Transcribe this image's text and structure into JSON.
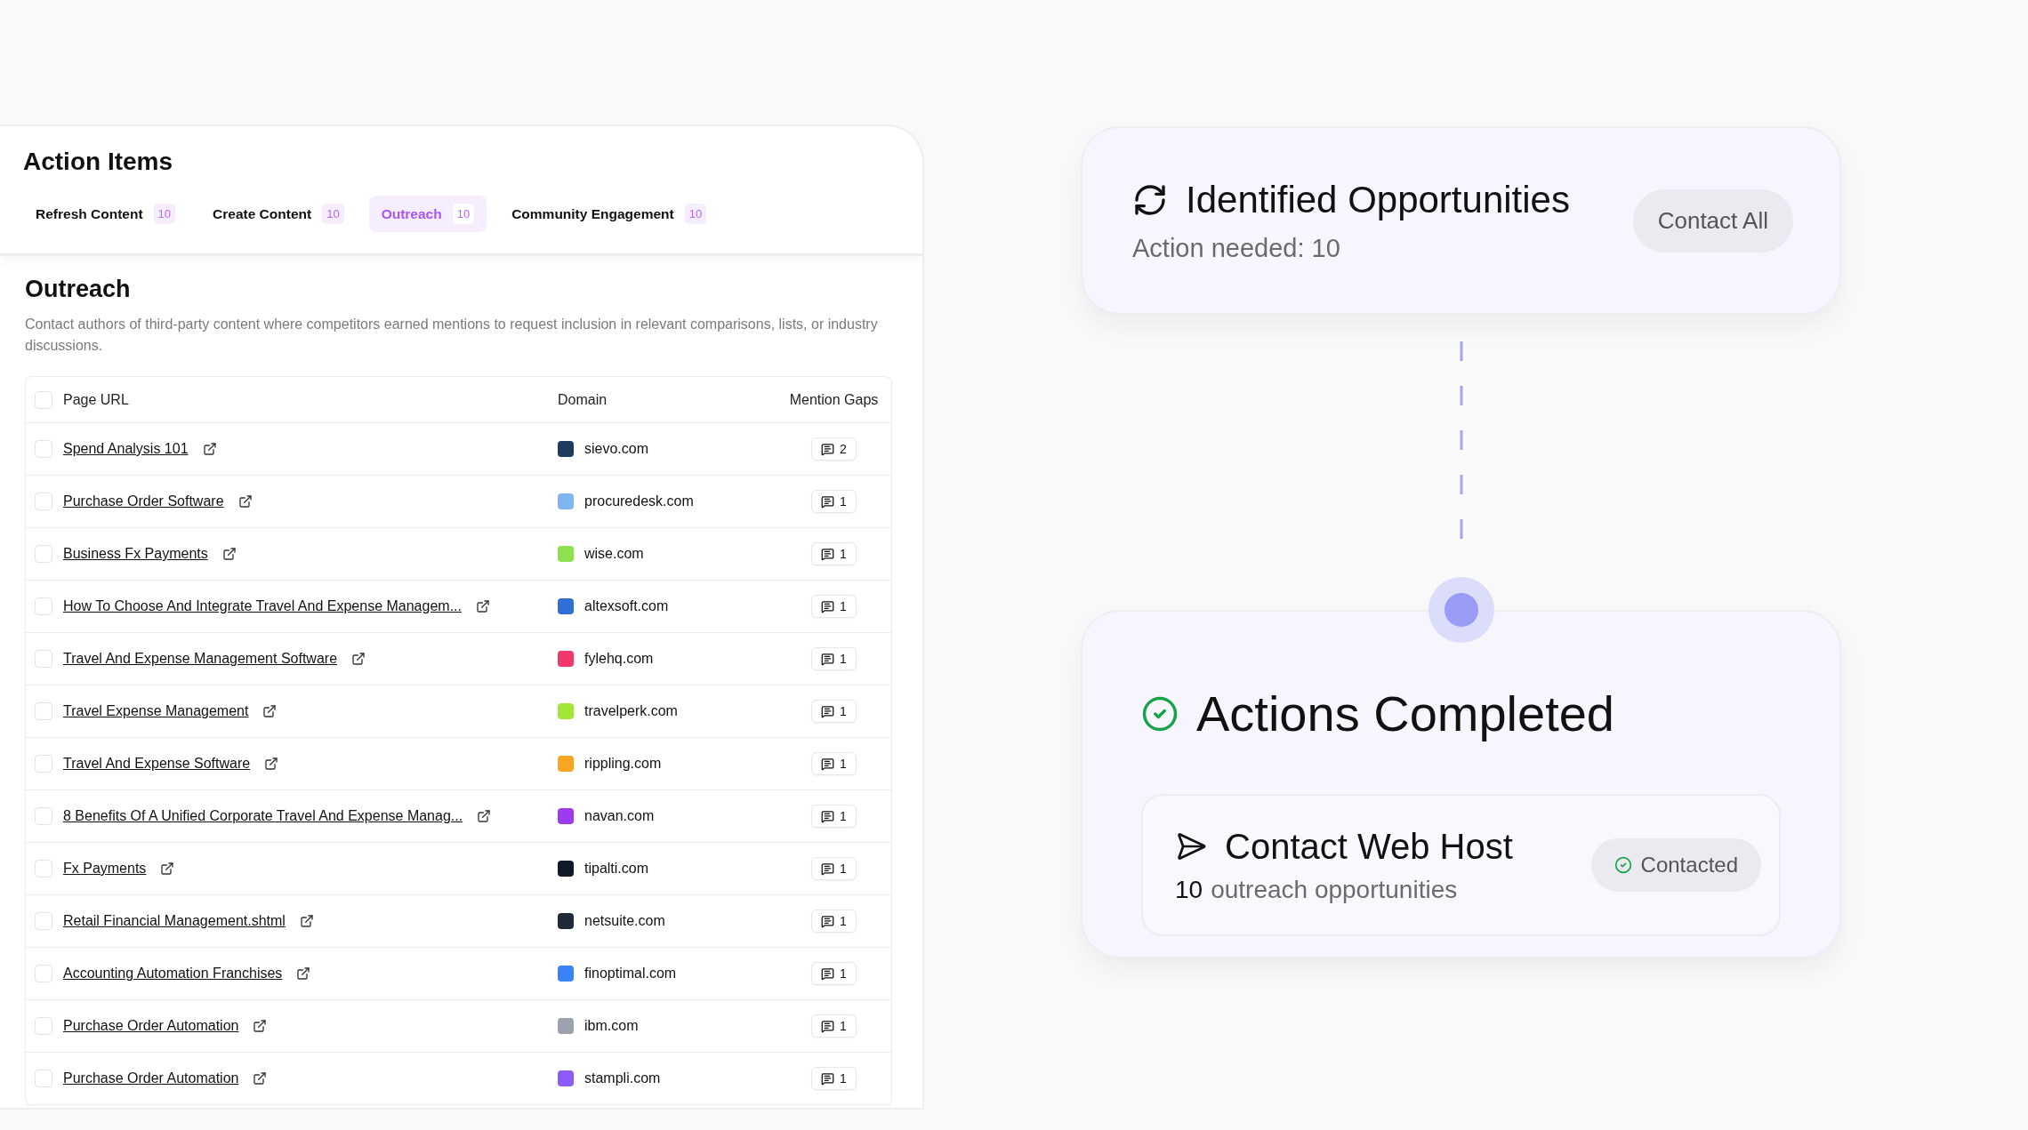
{
  "panel": {
    "title": "Action Items",
    "tabs": [
      {
        "label": "Refresh Content",
        "count": "10",
        "selected": false
      },
      {
        "label": "Create Content",
        "count": "10",
        "selected": false
      },
      {
        "label": "Outreach",
        "count": "10",
        "selected": true
      },
      {
        "label": "Community Engagement",
        "count": "10",
        "selected": false
      }
    ],
    "section": {
      "title": "Outreach",
      "description": "Contact authors of third-party content where competitors earned mentions to request inclusion in relevant comparisons, lists, or industry discussions."
    },
    "table": {
      "select_all_checked": false,
      "columns": [
        "Page URL",
        "Domain",
        "Mention Gaps"
      ],
      "rows": [
        {
          "checked": false,
          "page_url": "Spend Analysis 101",
          "domain": "sievo.com",
          "color": "#1e3a5f",
          "mention_gaps": "2"
        },
        {
          "checked": false,
          "page_url": "Purchase Order Software",
          "domain": "procuredesk.com",
          "color": "#7fb6f0",
          "mention_gaps": "1"
        },
        {
          "checked": false,
          "page_url": "Business Fx Payments",
          "domain": "wise.com",
          "color": "#8ee04f",
          "mention_gaps": "1"
        },
        {
          "checked": false,
          "page_url": "How To Choose And Integrate Travel And Expense Managem...",
          "domain": "altexsoft.com",
          "color": "#2f6fd6",
          "mention_gaps": "1"
        },
        {
          "checked": false,
          "page_url": "Travel And Expense Management Software",
          "domain": "fylehq.com",
          "color": "#f0386b",
          "mention_gaps": "1"
        },
        {
          "checked": false,
          "page_url": "Travel Expense Management",
          "domain": "travelperk.com",
          "color": "#a3e635",
          "mention_gaps": "1"
        },
        {
          "checked": false,
          "page_url": "Travel And Expense Software",
          "domain": "rippling.com",
          "color": "#f5a623",
          "mention_gaps": "1"
        },
        {
          "checked": false,
          "page_url": "8 Benefits Of A Unified Corporate Travel And Expense Manag...",
          "domain": "navan.com",
          "color": "#9b3cf0",
          "mention_gaps": "1"
        },
        {
          "checked": false,
          "page_url": "Fx Payments",
          "domain": "tipalti.com",
          "color": "#111827",
          "mention_gaps": "1"
        },
        {
          "checked": false,
          "page_url": "Retail Financial Management.shtml",
          "domain": "netsuite.com",
          "color": "#1f2937",
          "mention_gaps": "1"
        },
        {
          "checked": false,
          "page_url": "Accounting Automation Franchises",
          "domain": "finoptimal.com",
          "color": "#3b82f6",
          "mention_gaps": "1"
        },
        {
          "checked": false,
          "page_url": "Purchase Order Automation",
          "domain": "ibm.com",
          "color": "#9ca3af",
          "mention_gaps": "1"
        },
        {
          "checked": false,
          "page_url": "Purchase Order Automation",
          "domain": "stampli.com",
          "color": "#8b5cf6",
          "mention_gaps": "1"
        }
      ]
    }
  },
  "opportunities_card": {
    "title": "Identified Opportunities",
    "subtitle": "Action needed: 10",
    "button": "Contact All"
  },
  "completed_card": {
    "title": "Actions Completed",
    "action": {
      "title": "Contact Web Host",
      "count": "10",
      "text": "outreach opportunities",
      "status": "Contacted"
    }
  }
}
